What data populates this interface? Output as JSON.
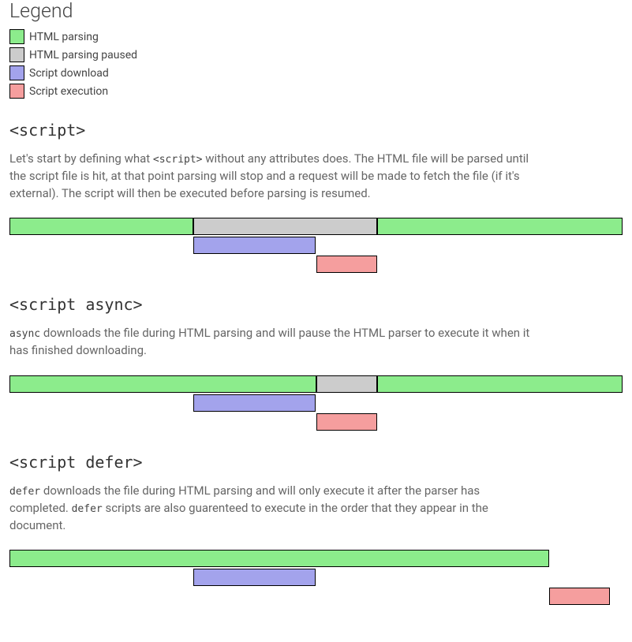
{
  "legend": {
    "title": "Legend",
    "items": [
      {
        "label": "HTML parsing",
        "color": "#8cec8c",
        "key": "htmlparsing"
      },
      {
        "label": "HTML parsing paused",
        "color": "#cccccc",
        "key": "htmlparsingpaused"
      },
      {
        "label": "Script download",
        "color": "#a3a3ec",
        "key": "scriptdownload"
      },
      {
        "label": "Script execution",
        "color": "#f59e9e",
        "key": "scriptexecution"
      }
    ]
  },
  "sections": [
    {
      "heading": "<script>",
      "desc_pre": "Let's start by defining what ",
      "desc_code1": "<script>",
      "desc_mid": " without any attributes does. The HTML file will be parsed until the script file is hit, at that point parsing will stop and a request will be made to fetch the file (if it's external). The script will then be executed before parsing is resumed.",
      "desc_code2": "",
      "desc_post": "",
      "timeline": {
        "tracks": [
          [
            {
              "key": "htmlparsing",
              "start": 0,
              "width": 30
            },
            {
              "key": "htmlparsingpaused",
              "start": 30,
              "width": 30
            },
            {
              "key": "htmlparsing",
              "start": 60,
              "width": 40
            }
          ],
          [
            {
              "key": "scriptdownload",
              "start": 30,
              "width": 20
            }
          ],
          [
            {
              "key": "scriptexecution",
              "start": 50,
              "width": 10
            }
          ]
        ]
      }
    },
    {
      "heading": "<script async>",
      "desc_pre": "",
      "desc_code1": "async",
      "desc_mid": " downloads the file during HTML parsing and will pause the HTML parser to execute it when it has finished downloading.",
      "desc_code2": "",
      "desc_post": "",
      "timeline": {
        "tracks": [
          [
            {
              "key": "htmlparsing",
              "start": 0,
              "width": 50
            },
            {
              "key": "htmlparsingpaused",
              "start": 50,
              "width": 10
            },
            {
              "key": "htmlparsing",
              "start": 60,
              "width": 40
            }
          ],
          [
            {
              "key": "scriptdownload",
              "start": 30,
              "width": 20
            }
          ],
          [
            {
              "key": "scriptexecution",
              "start": 50,
              "width": 10
            }
          ]
        ]
      }
    },
    {
      "heading": "<script defer>",
      "desc_pre": "",
      "desc_code1": "defer",
      "desc_mid": " downloads the file during HTML parsing and will only execute it after the parser has completed. ",
      "desc_code2": "defer",
      "desc_post": " scripts are also guarenteed to execute in the order that they appear in the document.",
      "timeline": {
        "tracks": [
          [
            {
              "key": "htmlparsing",
              "start": 0,
              "width": 88
            }
          ],
          [
            {
              "key": "scriptdownload",
              "start": 30,
              "width": 20
            }
          ],
          [
            {
              "key": "scriptexecution",
              "start": 88,
              "width": 10
            }
          ]
        ]
      }
    }
  ]
}
